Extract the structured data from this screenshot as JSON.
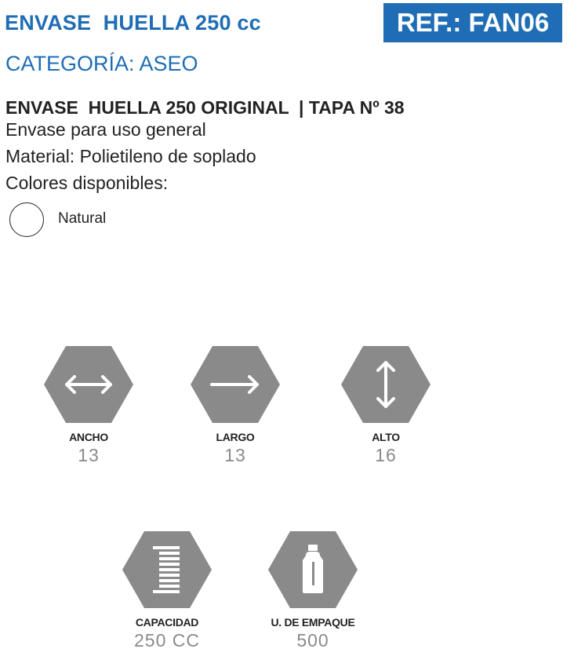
{
  "header": {
    "title": "ENVASE  HUELLA 250 cc",
    "ref": "REF.: FAN06",
    "category": "CATEGORÍA: ASEO",
    "accent_color": "#1f6db5"
  },
  "product": {
    "name": "ENVASE  HUELLA 250 ORIGINAL  | TAPA Nº 38",
    "lines": [
      "Envase para uso general",
      "Material: Polietileno de soplado",
      "Colores disponibles:"
    ],
    "colors": [
      {
        "name": "Natural",
        "swatch": "#ffffff"
      }
    ]
  },
  "specs": [
    {
      "key": "ancho",
      "icon": "horizontal-double-arrow-icon",
      "label": "ANCHO",
      "value": "13"
    },
    {
      "key": "largo",
      "icon": "right-arrow-icon",
      "label": "LARGO",
      "value": "13"
    },
    {
      "key": "alto",
      "icon": "vertical-double-arrow-icon",
      "label": "ALTO",
      "value": "16"
    },
    {
      "key": "capacidad",
      "icon": "capacity-stack-icon",
      "label": "CAPACIDAD",
      "value": "250 CC"
    },
    {
      "key": "empaque",
      "icon": "bottle-icon",
      "label": "U. DE EMPAQUE",
      "value": "500"
    }
  ],
  "icon_color": "#8a8a8a"
}
